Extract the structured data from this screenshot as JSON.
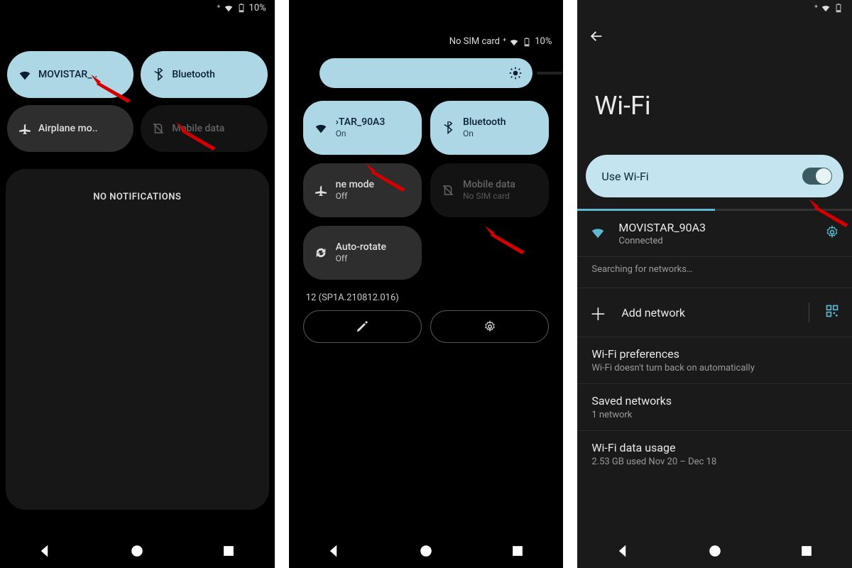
{
  "status": {
    "battery_pct": "10%",
    "no_sim": "No SIM card"
  },
  "panel1": {
    "wifi_label": "MOVISTAR_..",
    "bluetooth_label": "Bluetooth",
    "airplane_label": "Airplane mo..",
    "mobiledata_label": "Mobile data",
    "no_notifications": "NO NOTIFICATIONS"
  },
  "panel2": {
    "tiles": {
      "wifi": {
        "title": "›TAR_90A3",
        "sub": "On"
      },
      "bluetooth": {
        "title": "Bluetooth",
        "sub": "On"
      },
      "airplane": {
        "title": "ne mode",
        "sub": "Off"
      },
      "mobiledata": {
        "title": "Mobile data",
        "sub": "No SIM card"
      },
      "autorotate": {
        "title": "Auto-rotate",
        "sub": "Off"
      }
    },
    "build": "12 (SP1A.210812.016)"
  },
  "panel3": {
    "title": "Wi-Fi",
    "use_wifi": "Use Wi-Fi",
    "network": {
      "name": "MOVISTAR_90A3",
      "status": "Connected"
    },
    "searching": "Searching for networks…",
    "add_network": "Add network",
    "prefs": {
      "t": "Wi-Fi preferences",
      "s": "Wi-Fi doesn't turn back on automatically"
    },
    "saved": {
      "t": "Saved networks",
      "s": "1 network"
    },
    "usage": {
      "t": "Wi-Fi data usage",
      "s": "2.53 GB used Nov 20 – Dec 18"
    }
  }
}
